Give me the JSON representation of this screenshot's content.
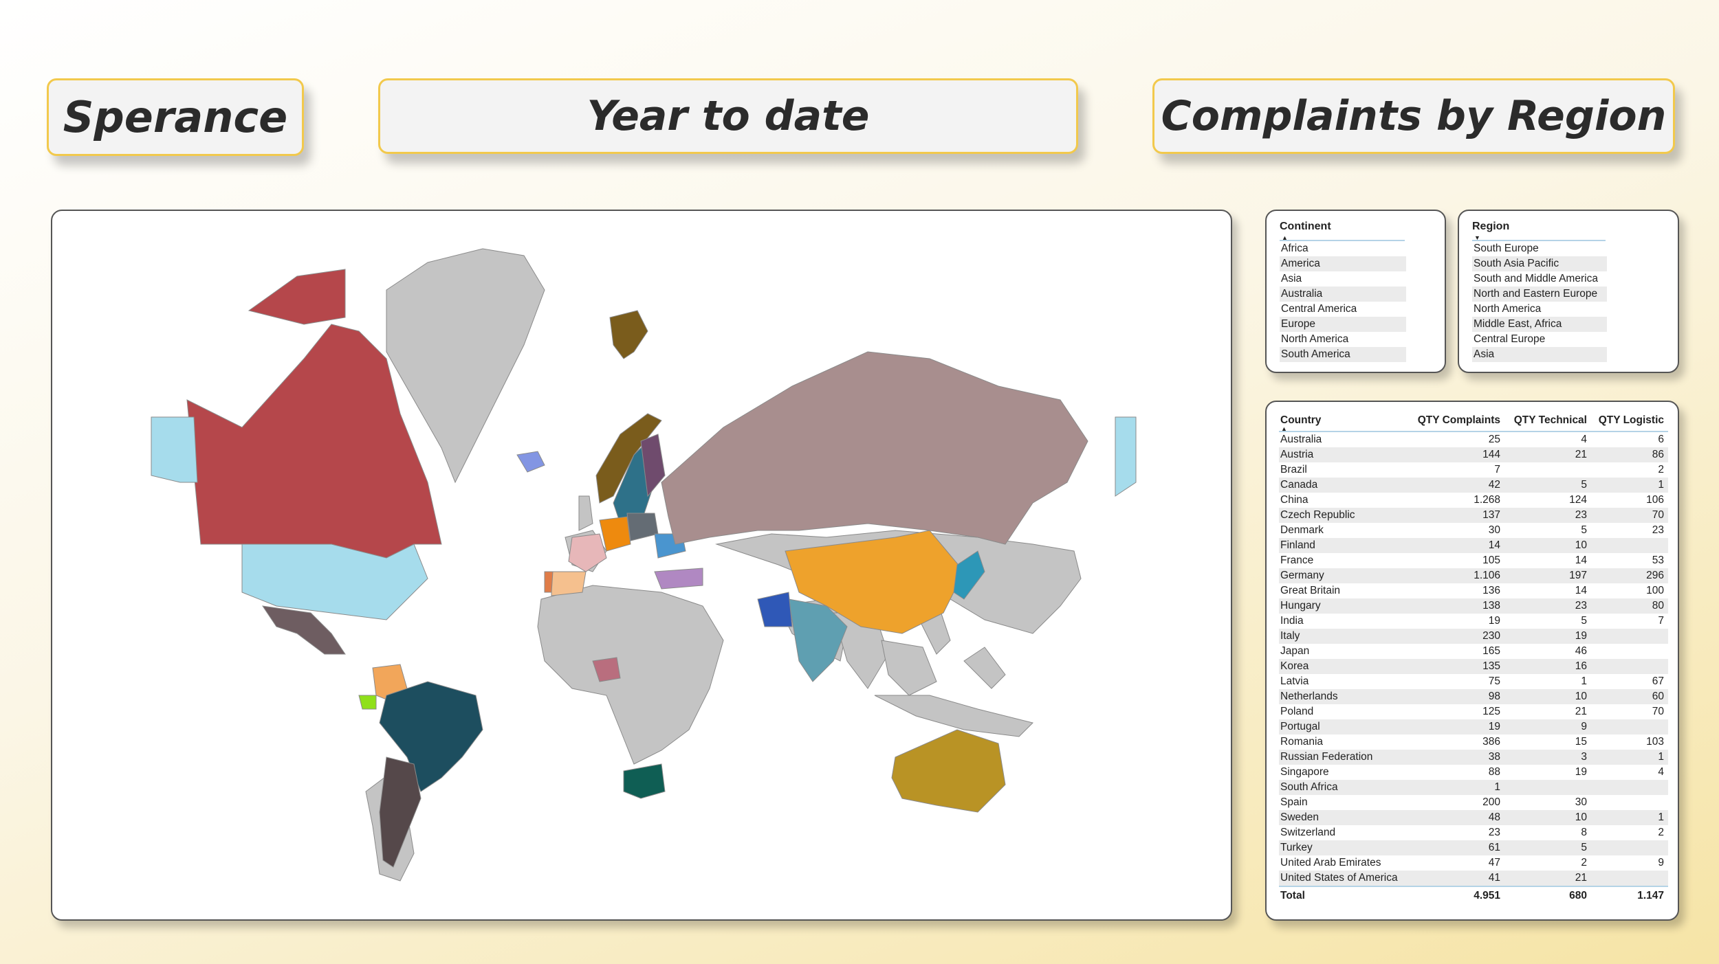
{
  "header": {
    "brand": "Sperance",
    "period": "Year to date",
    "title": "Complaints by Region"
  },
  "continent_slicer": {
    "title": "Continent",
    "items": [
      "Africa",
      "America",
      "Asia",
      "Australia",
      "Central America",
      "Europe",
      "North America",
      "South America"
    ]
  },
  "region_slicer": {
    "title": "Region",
    "items": [
      "South Europe",
      "South Asia Pacific",
      "South and Middle America",
      "North and Eastern Europe",
      "North America",
      "Middle East, Africa",
      "Central Europe",
      "Asia"
    ]
  },
  "table": {
    "columns": [
      "Country",
      "QTY Complaints",
      "QTY Technical",
      "QTY Logistic"
    ],
    "rows": [
      [
        "Australia",
        "25",
        "4",
        "6"
      ],
      [
        "Austria",
        "144",
        "21",
        "86"
      ],
      [
        "Brazil",
        "7",
        "",
        "2"
      ],
      [
        "Canada",
        "42",
        "5",
        "1"
      ],
      [
        "China",
        "1.268",
        "124",
        "106"
      ],
      [
        "Czech Republic",
        "137",
        "23",
        "70"
      ],
      [
        "Denmark",
        "30",
        "5",
        "23"
      ],
      [
        "Finland",
        "14",
        "10",
        ""
      ],
      [
        "France",
        "105",
        "14",
        "53"
      ],
      [
        "Germany",
        "1.106",
        "197",
        "296"
      ],
      [
        "Great Britain",
        "136",
        "14",
        "100"
      ],
      [
        "Hungary",
        "138",
        "23",
        "80"
      ],
      [
        "India",
        "19",
        "5",
        "7"
      ],
      [
        "Italy",
        "230",
        "19",
        ""
      ],
      [
        "Japan",
        "165",
        "46",
        ""
      ],
      [
        "Korea",
        "135",
        "16",
        ""
      ],
      [
        "Latvia",
        "75",
        "1",
        "67"
      ],
      [
        "Netherlands",
        "98",
        "10",
        "60"
      ],
      [
        "Poland",
        "125",
        "21",
        "70"
      ],
      [
        "Portugal",
        "19",
        "9",
        ""
      ],
      [
        "Romania",
        "386",
        "15",
        "103"
      ],
      [
        "Russian Federation",
        "38",
        "3",
        "1"
      ],
      [
        "Singapore",
        "88",
        "19",
        "4"
      ],
      [
        "South Africa",
        "1",
        "",
        ""
      ],
      [
        "Spain",
        "200",
        "30",
        ""
      ],
      [
        "Sweden",
        "48",
        "10",
        "1"
      ],
      [
        "Switzerland",
        "23",
        "8",
        "2"
      ],
      [
        "Turkey",
        "61",
        "5",
        ""
      ],
      [
        "United Arab Emirates",
        "47",
        "2",
        "9"
      ],
      [
        "United States of America",
        "41",
        "21",
        ""
      ]
    ],
    "total": [
      "Total",
      "4.951",
      "680",
      "1.147"
    ]
  },
  "map": {
    "neutral_color": "#c4c4c4",
    "countries": [
      {
        "name": "Canada",
        "color": "#b5474b"
      },
      {
        "name": "Greenland",
        "color": "#c4c4c4"
      },
      {
        "name": "Alaska",
        "color": "#a6dcec"
      },
      {
        "name": "United States of America",
        "color": "#a6dcec"
      },
      {
        "name": "Mexico",
        "color": "#6e5d61"
      },
      {
        "name": "Colombia",
        "color": "#f2a65a"
      },
      {
        "name": "Ecuador",
        "color": "#8fe01a"
      },
      {
        "name": "Brazil",
        "color": "#1d4e5f"
      },
      {
        "name": "Argentina",
        "color": "#55484a"
      },
      {
        "name": "Iceland",
        "color": "#8295e3"
      },
      {
        "name": "Svalbard",
        "color": "#7a5c1c"
      },
      {
        "name": "Norway",
        "color": "#7a5c1c"
      },
      {
        "name": "Sweden",
        "color": "#2e7189"
      },
      {
        "name": "Finland",
        "color": "#6f4b6d"
      },
      {
        "name": "Great Britain",
        "color": "#c4c4c4"
      },
      {
        "name": "France",
        "color": "#e7b7b9"
      },
      {
        "name": "Spain",
        "color": "#f5c08e"
      },
      {
        "name": "Portugal",
        "color": "#e07c48"
      },
      {
        "name": "Germany",
        "color": "#ee8a0e"
      },
      {
        "name": "Poland",
        "color": "#646c74"
      },
      {
        "name": "Romania",
        "color": "#4a95cf"
      },
      {
        "name": "Turkey",
        "color": "#b088c2"
      },
      {
        "name": "Russian Federation",
        "color": "#a88e8e"
      },
      {
        "name": "China",
        "color": "#eea22c"
      },
      {
        "name": "India",
        "color": "#5f9fb1"
      },
      {
        "name": "Pakistan",
        "color": "#2f58b7"
      },
      {
        "name": "Japan",
        "color": "#2d97b7"
      },
      {
        "name": "Nigeria",
        "color": "#b96e7e"
      },
      {
        "name": "South Africa",
        "color": "#0f5e54"
      },
      {
        "name": "Australia",
        "color": "#b99325"
      }
    ]
  }
}
